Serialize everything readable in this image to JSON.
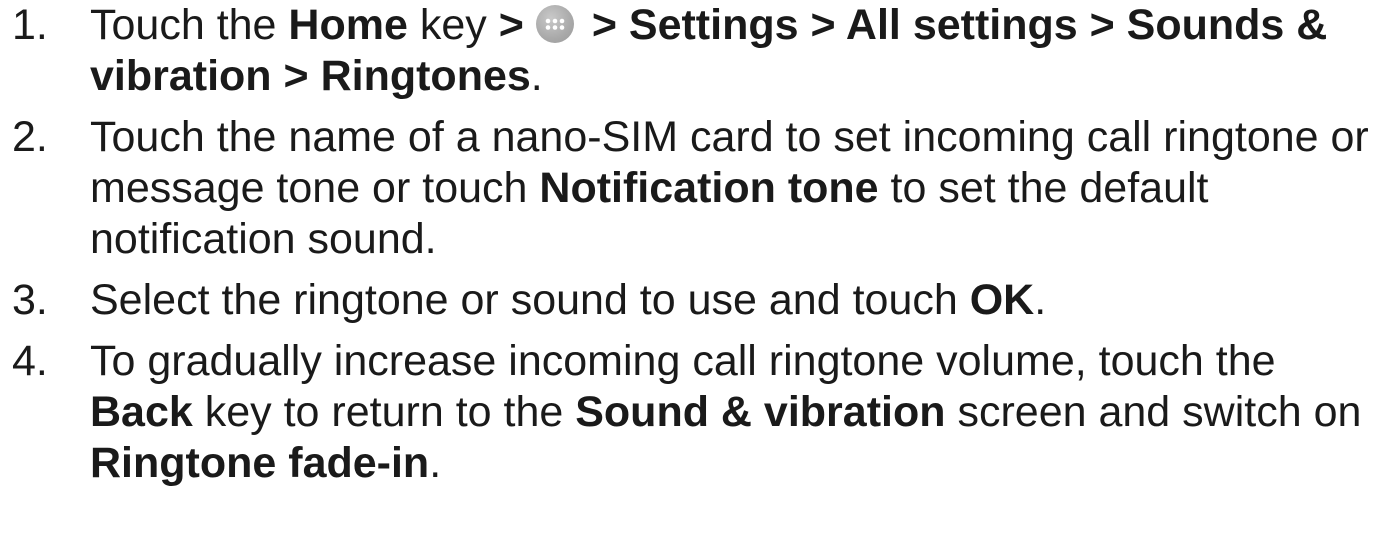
{
  "steps": [
    {
      "num": "1.",
      "parts": [
        {
          "t": "Touch the ",
          "b": false
        },
        {
          "t": "Home",
          "b": true
        },
        {
          "t": " key ",
          "b": false
        },
        {
          "t": ">",
          "b": true
        },
        {
          "icon": "apps-grid-icon"
        },
        {
          "t": "> Settings > All settings > Sounds & vibration > Ringtones",
          "b": true
        },
        {
          "t": ".",
          "b": false
        }
      ]
    },
    {
      "num": "2.",
      "parts": [
        {
          "t": "Touch the name of a nano-SIM card to set incoming call ringtone or message tone or touch ",
          "b": false
        },
        {
          "t": "Notification tone",
          "b": true
        },
        {
          "t": " to set the default notification sound.",
          "b": false
        }
      ]
    },
    {
      "num": "3.",
      "parts": [
        {
          "t": "Select the ringtone or sound to use and touch ",
          "b": false
        },
        {
          "t": "OK",
          "b": true
        },
        {
          "t": ".",
          "b": false
        }
      ]
    },
    {
      "num": "4.",
      "parts": [
        {
          "t": "To gradually increase incoming call ringtone volume, touch the ",
          "b": false
        },
        {
          "t": "Back",
          "b": true
        },
        {
          "t": " key to return to the ",
          "b": false
        },
        {
          "t": "Sound & vibration",
          "b": true
        },
        {
          "t": " screen and switch on ",
          "b": false
        },
        {
          "t": "Ringtone fade-in",
          "b": true
        },
        {
          "t": ".",
          "b": false
        }
      ]
    }
  ],
  "icons": {
    "apps_icon_color": "#a9a9a9"
  }
}
